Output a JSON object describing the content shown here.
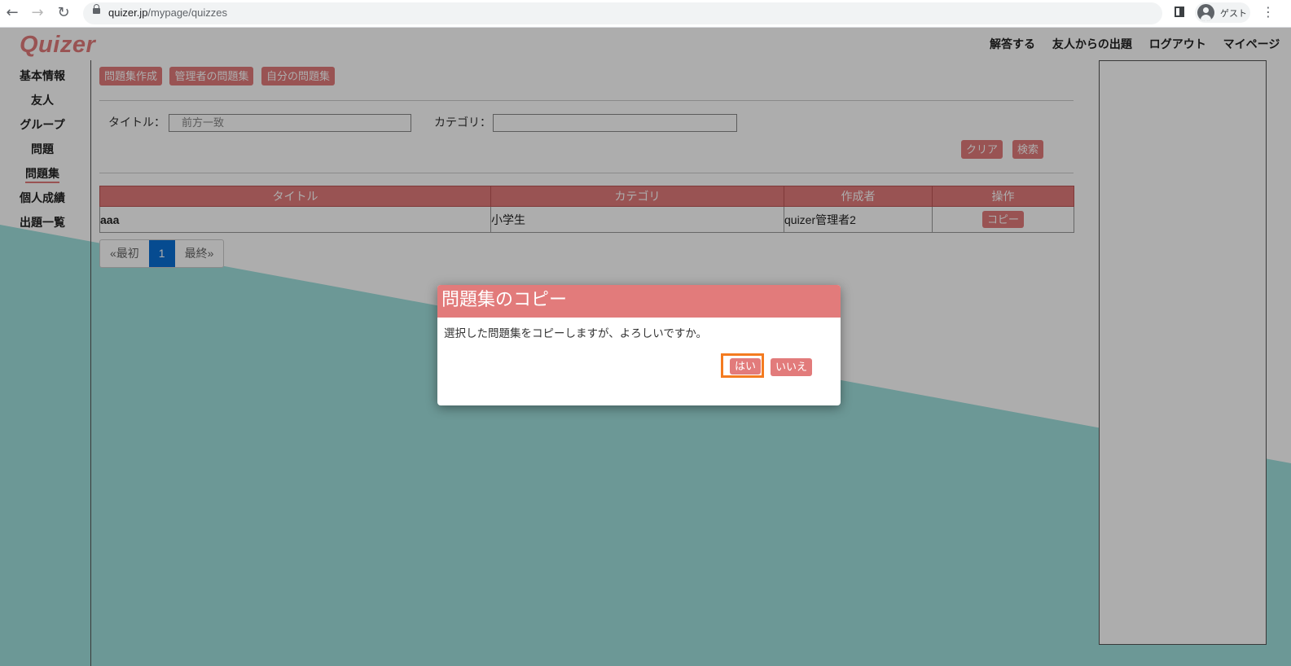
{
  "browser": {
    "url_host": "quizer.jp",
    "url_path": "/mypage/quizzes",
    "profile_label": "ゲスト"
  },
  "site": {
    "logo": "Quizer",
    "top_nav": [
      "解答する",
      "友人からの出題",
      "ログアウト",
      "マイページ"
    ]
  },
  "sidebar": {
    "items": [
      {
        "label": "基本情報"
      },
      {
        "label": "友人"
      },
      {
        "label": "グループ"
      },
      {
        "label": "問題"
      },
      {
        "label": "問題集",
        "active": true
      },
      {
        "label": "個人成績"
      },
      {
        "label": "出題一覧"
      }
    ]
  },
  "tabs": [
    "問題集作成",
    "管理者の問題集",
    "自分の問題集"
  ],
  "search": {
    "title_label": "タイトル：",
    "title_placeholder": "前方一致",
    "category_label": "カテゴリ：",
    "category_value": "",
    "clear_label": "クリア",
    "search_label": "検索"
  },
  "table": {
    "headers": [
      "タイトル",
      "カテゴリ",
      "作成者",
      "操作"
    ],
    "rows": [
      {
        "title": "aaa",
        "category": "小学生",
        "author": "quizer管理者2",
        "action": "コピー"
      }
    ]
  },
  "pager": {
    "first": "«最初",
    "current": "1",
    "last": "最終»"
  },
  "dialog": {
    "title": "問題集のコピー",
    "message": "選択した問題集をコピーしますが、よろしいですか。",
    "yes": "はい",
    "no": "いいえ"
  },
  "colors": {
    "accent": "#e27b7b",
    "teal_bg": "#a0e0de",
    "pager_active": "#0a6fd4",
    "focus_ring": "#f47b20"
  }
}
